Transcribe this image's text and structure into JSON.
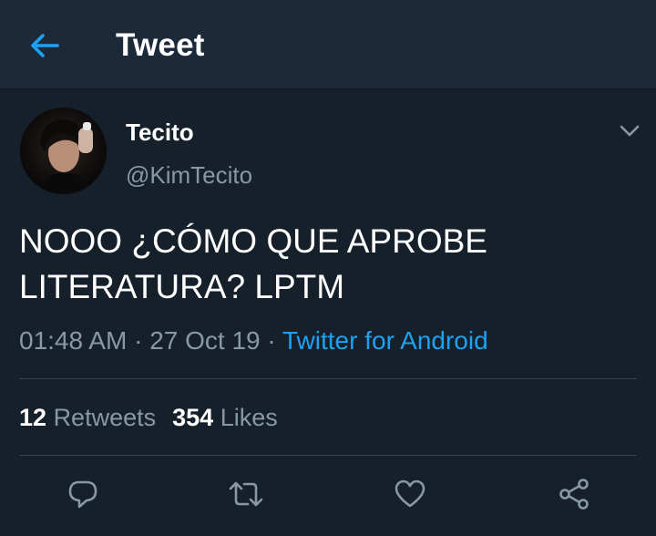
{
  "header": {
    "back_icon": "arrow-left-icon",
    "title": "Tweet"
  },
  "author": {
    "name": "Tecito",
    "handle": "@KimTecito"
  },
  "tweet": {
    "text": "NOOO ¿CÓMO QUE APROBE\nLITERATURA? LPTM",
    "time": "01:48 AM",
    "date": "27 Oct 19",
    "separator": "·",
    "source": "Twitter for Android"
  },
  "stats": {
    "retweets_count": "12",
    "retweets_label": "Retweets",
    "likes_count": "354",
    "likes_label": "Likes"
  },
  "actions": [
    "reply-icon",
    "retweet-icon",
    "like-icon",
    "share-icon"
  ],
  "colors": {
    "background": "#15202b",
    "header_background": "#1c2938",
    "accent": "#1da1f2",
    "secondary_text": "#8899a6",
    "divider": "#38444d"
  }
}
